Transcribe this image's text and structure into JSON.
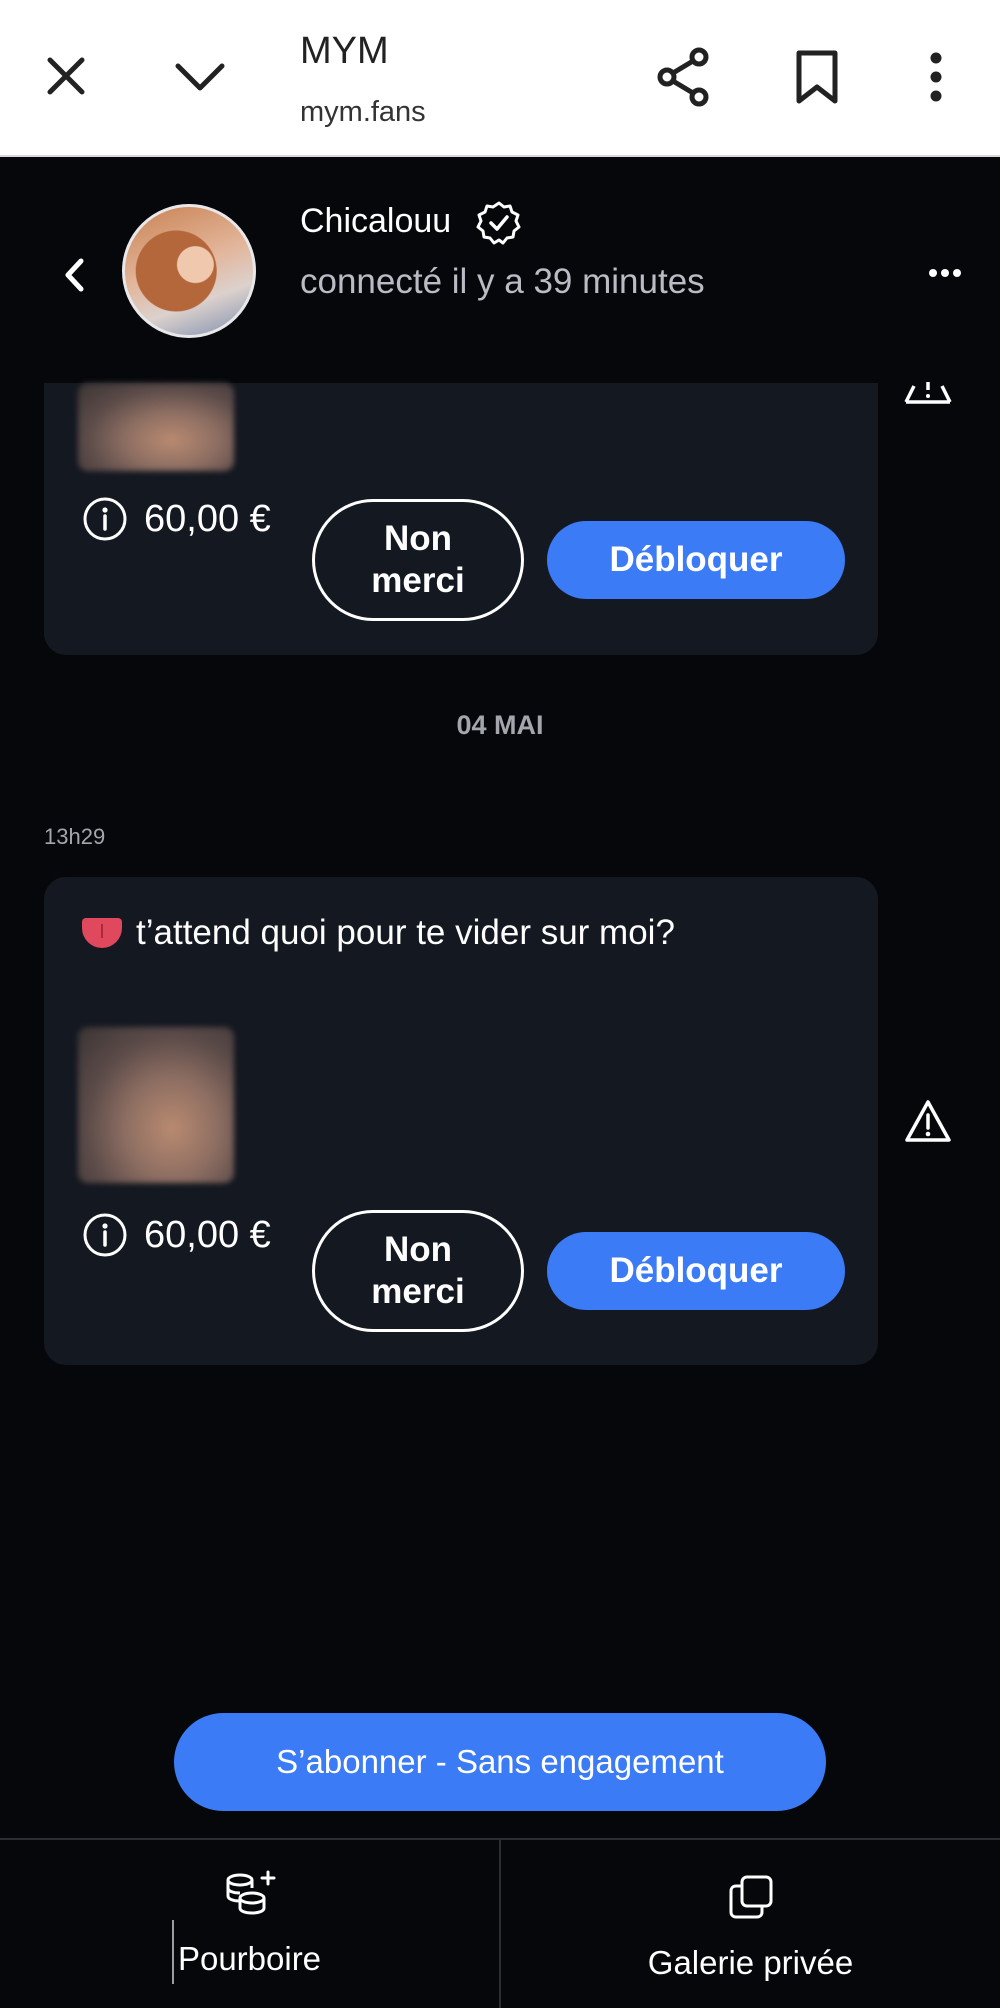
{
  "browser": {
    "title": "MYM",
    "url": "mym.fans"
  },
  "chat_header": {
    "creator_name": "Chicalouu",
    "status": "connecté il y a 39 minutes"
  },
  "messages": [
    {
      "price": "60,00 €",
      "decline_label": "Non merci",
      "unlock_label": "Débloquer"
    },
    {
      "date_separator": "04 MAI",
      "time": "13h29",
      "text": "t’attend quoi pour te vider sur moi?",
      "emoji": "tongue-emoji",
      "price": "60,00 €",
      "decline_label": "Non merci",
      "unlock_label": "Débloquer"
    }
  ],
  "subscribe_label": "S’abonner - Sans engagement",
  "bottom_tabs": [
    {
      "label": "Pourboire",
      "icon": "coins-plus-icon"
    },
    {
      "label": "Galerie privée",
      "icon": "gallery-copy-icon"
    }
  ],
  "colors": {
    "background": "#05070b",
    "bubble": "#141821",
    "accent": "#3b7bf6"
  }
}
